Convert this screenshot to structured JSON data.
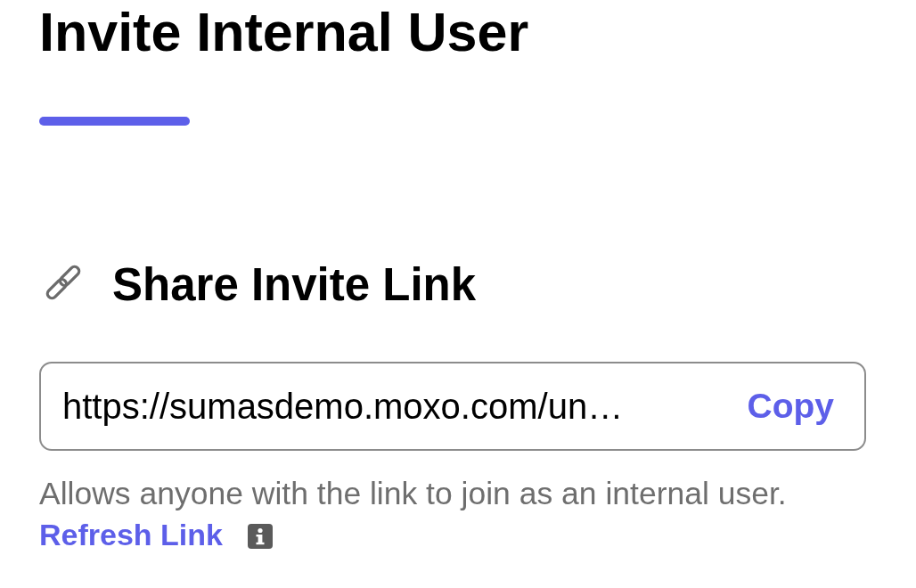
{
  "title": "Invite Internal User",
  "share_section": {
    "heading": "Share Invite Link",
    "link_field": {
      "value": "https://sumasdemo.moxo.com/un…"
    },
    "copy_button": "Copy",
    "description": "Allows anyone with the link to join as an internal user.",
    "refresh_link": "Refresh Link"
  }
}
